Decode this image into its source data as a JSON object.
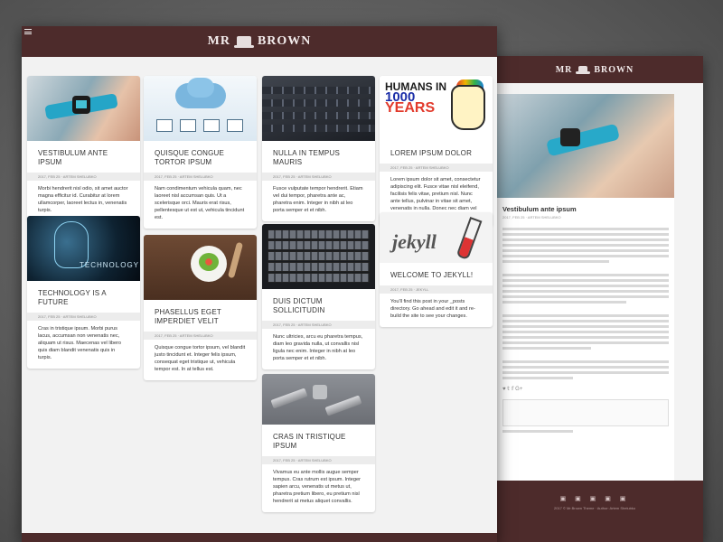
{
  "brand": {
    "left": "MR",
    "right": "BROWN"
  },
  "posts": [
    {
      "title": "VESTIBULUM ANTE IPSUM",
      "meta": "2017, FEB 25 · ARTEM SHELUBKO",
      "excerpt": "Morbi hendrerit nisl odio, sit amet auctor magna efficitur id. Curabitur at lorem ullamcorper, laoreet lectus in, venenatis turpis."
    },
    {
      "title": "QUISQUE CONGUE TORTOR IPSUM",
      "meta": "2017, FEB 25 · ARTEM SHELUBKO",
      "excerpt": "Nam condimentum vehicula quam, nec laoreet nisl accumsan quis. Ut a scelerisque orci. Mauris erat risus, pellentesque ut est ut, vehicula tincidunt est."
    },
    {
      "title": "NULLA IN TEMPUS MAURIS",
      "meta": "2017, FEB 25 · ARTEM SHELUBKO",
      "excerpt": "Fusce vulputate tempor hendrerit. Etiam vel dui tempor, pharetra ante ac, pharetra enim. Integer in nibh at leo porta semper et et nibh."
    },
    {
      "title": "LOREM IPSUM DOLOR",
      "meta": "2017, FEB 25 · ARTEM SHELUBKO",
      "excerpt": "Lorem ipsum dolor sit amet, consectetur adipiscing elit. Fusce vitae nisl eleifend, facilisis felis vitae, pretium nisl. Nunc ante tellus, pulvinar in vitae sit amet, venenatis in nulla. Donec nec diam vel lectus dictum lacinia."
    },
    {
      "title": "TECHNOLOGY IS A FUTURE",
      "meta": "2017, FEB 25 · ARTEM SHELUBKO",
      "excerpt": "Cras in tristique ipsum. Morbi purus lacus, accumsan non venenatis nec, aliquam ut risus. Maecenas vel libero quis diam blandit venenatis quis in turpis."
    },
    {
      "title": "PHASELLUS EGET IMPERDIET VELIT",
      "meta": "2017, FEB 25 · ARTEM SHELUBKO",
      "excerpt": "Quisque congue tortor ipsum, vel blandit justo tincidunt et. Integer felis ipsum, consequat eget tristique ut, vehicula tempor est. In at tellus est."
    },
    {
      "title": "DUIS DICTUM SOLLICITUDIN",
      "meta": "2017, FEB 25 · ARTEM SHELUBKO",
      "excerpt": "Nunc ultricies, arcu eu pharetra tempus, diam leo gravida nulla, ut convallis nisl ligula nec enim. Integer in nibh at leo porta semper et et nibh."
    },
    {
      "title": "WELCOME TO JEKYLL!",
      "meta": "2017, FEB 25 · JEKYLL",
      "excerpt": "You'll find this post in your _posts directory. Go ahead and edit it and re-build the site to see your changes."
    },
    {
      "title": "CRAS IN TRISTIQUE IPSUM",
      "meta": "2017, FEB 25 · ARTEM SHELUBKO",
      "excerpt": "Vivamus eu ante mollis augue semper tempus. Cras rutrum est ipsum. Integer sapien arcu, venenatis ut metus ut, pharetra pretium libero, eu pretium nisl hendrerit at metus aliquet convallis."
    }
  ],
  "detail": {
    "title": "Vestibulum ante ipsum",
    "meta": "2017, FEB 25 · ARTEM SHELUBKO",
    "social": "♥ 𝕥 𝕗 G+",
    "footer_icons": "▣ ▣ ▣ ▣ ▣",
    "footer_text": "2017 © Mr.Brown Theme · Author: Artem Shelubko"
  }
}
